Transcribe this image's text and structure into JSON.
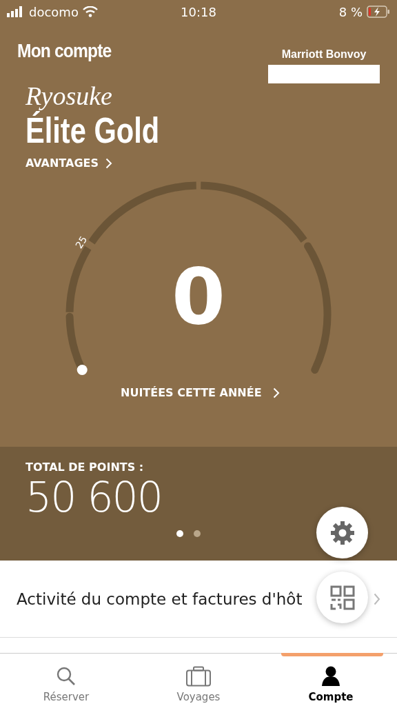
{
  "status_bar": {
    "carrier": "docomo",
    "time": "10:18",
    "battery": "8 %"
  },
  "header": {
    "title": "Mon compte",
    "brand": "Marriott Bonvoy"
  },
  "member": {
    "first_name": "Ryosuke",
    "tier": "Élite Gold",
    "benefits_link": "AVANTAGES"
  },
  "gauge": {
    "value": "0",
    "tick_label": "25",
    "caption": "NUITÉES CETTE ANNÉE"
  },
  "points": {
    "label": "TOTAL DE POINTS :",
    "value": "50 600"
  },
  "pager": [
    {
      "selected": true
    },
    {
      "selected": false
    }
  ],
  "list": [
    {
      "label": "Activité du compte et factures d'hôt"
    }
  ],
  "tabs": [
    {
      "label": "Réserver",
      "kind": "search",
      "selected": false
    },
    {
      "label": "Voyages",
      "kind": "suitcase",
      "selected": false
    },
    {
      "label": "Compte",
      "kind": "person",
      "selected": true
    }
  ]
}
